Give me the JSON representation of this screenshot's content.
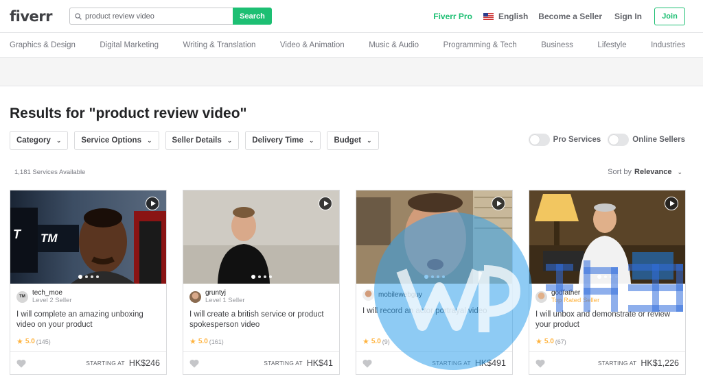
{
  "header": {
    "logo": "fiverr",
    "search_value": "product review video",
    "search_button": "Search",
    "fiverr_pro": "Fiverr Pro",
    "language": "English",
    "become_seller": "Become a Seller",
    "sign_in": "Sign In",
    "join": "Join"
  },
  "categories": [
    "Graphics & Design",
    "Digital Marketing",
    "Writing & Translation",
    "Video & Animation",
    "Music & Audio",
    "Programming & Tech",
    "Business",
    "Lifestyle",
    "Industries"
  ],
  "results": {
    "title": "Results for \"product review video\"",
    "filters": [
      "Category",
      "Service Options",
      "Seller Details",
      "Delivery Time",
      "Budget"
    ],
    "pro_services": "Pro Services",
    "online_sellers": "Online Sellers",
    "count": "1,181 Services Available",
    "sort_label": "Sort by",
    "sort_value": "Relevance"
  },
  "gigs": [
    {
      "seller": "tech_moe",
      "level": "Level 2 Seller",
      "title": "I will complete an amazing unboxing video on your product",
      "rating": "5.0",
      "reviews": "(145)",
      "starting": "STARTING AT",
      "price": "HK$246"
    },
    {
      "seller": "gruntyj",
      "level": "Level 1 Seller",
      "title": "I will create a british service or product spokesperson video",
      "rating": "5.0",
      "reviews": "(161)",
      "starting": "STARTING AT",
      "price": "HK$41"
    },
    {
      "seller": "mobilewebguy",
      "level": "",
      "title": "I will record an actor portrayal video",
      "rating": "5.0",
      "reviews": "(9)",
      "starting": "STARTING AT",
      "price": "HK$491"
    },
    {
      "seller": "godfather",
      "level": "Top Rated Seller",
      "title": "I will unbox and demonstrate or review your product",
      "rating": "5.0",
      "reviews": "(67)",
      "starting": "STARTING AT",
      "price": "HK$1,226"
    }
  ],
  "colors": {
    "brand": "#1dbf73",
    "star": "#ffb33e",
    "text": "#404145"
  },
  "icons": [
    "search-icon",
    "us-flag-icon",
    "chevron-down-icon",
    "play-icon",
    "star-icon",
    "heart-icon"
  ]
}
